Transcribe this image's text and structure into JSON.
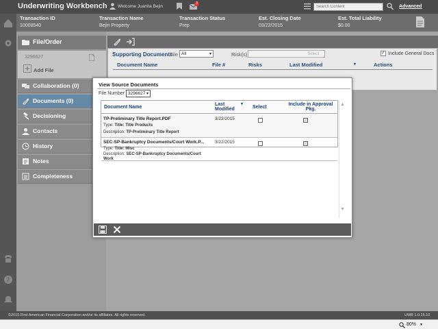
{
  "app": {
    "title": "Underwriting Workbench",
    "welcome": "Welcome Juanita Bejin",
    "mail_count": "3",
    "search_placeholder": "Search Content",
    "advanced_label": "Advanced"
  },
  "info": {
    "transaction_id_label": "Transaction ID",
    "transaction_id": "10008540",
    "transaction_name_label": "Transaction Name",
    "transaction_name": "Bejin Property",
    "transaction_status_label": "Transaction Status",
    "transaction_status": "Prep",
    "closing_date_label": "Est. Closing Date",
    "closing_date": "03/22/2015",
    "liability_label": "Est. Total Liability",
    "liability": "$0.00"
  },
  "sidebar": {
    "file_order_label": "File/Order",
    "file_number": "3296627",
    "add_file_label": "Add File",
    "items": [
      {
        "label": "Collaboration (0)"
      },
      {
        "label": "Documents (0)"
      },
      {
        "label": "Decisioning"
      },
      {
        "label": "Contacts"
      },
      {
        "label": "History"
      },
      {
        "label": "Notes"
      },
      {
        "label": "Completeness"
      }
    ]
  },
  "supporting": {
    "title": "Supporting Documents",
    "file_label": "File",
    "file_value": "All",
    "risks_label": "Risk(s)",
    "risks_placeholder": "Select",
    "include_label": "Include General Docs",
    "columns": [
      "Document Name",
      "File #",
      "Risks",
      "Last Modified",
      "Actions"
    ]
  },
  "modal": {
    "title": "View Source Documents",
    "file_number_label": "File Number",
    "file_number_value": "3296627",
    "columns": {
      "name": "Document Name",
      "last_modified_1": "Last",
      "last_modified_2": "Modified",
      "select": "Select",
      "include_1": "Include in Approval",
      "include_2": "Pkg."
    },
    "rows": [
      {
        "name": "TP-Preliminary Title Report.PDF",
        "type_label": "Type:",
        "type": "Title: Title Products",
        "desc_label": "Description:",
        "desc": "TP-Preliminary Title Report",
        "date": "3/22/2015"
      },
      {
        "name": "SEC-SP-Bankruptcy Documents/Court Work.P...",
        "type_label": "Type:",
        "type": "Title: Misc",
        "desc_label": "Description:",
        "desc": "SEC-SP-Bankruptcy Documents/Court Work",
        "date": "3/22/2015"
      }
    ]
  },
  "footer": {
    "copyright": "©2015 First American Financial Corporation and/or its affiliates. All rights reserved.",
    "version": "UWB 1.0.15.10",
    "zoom": "80%"
  }
}
